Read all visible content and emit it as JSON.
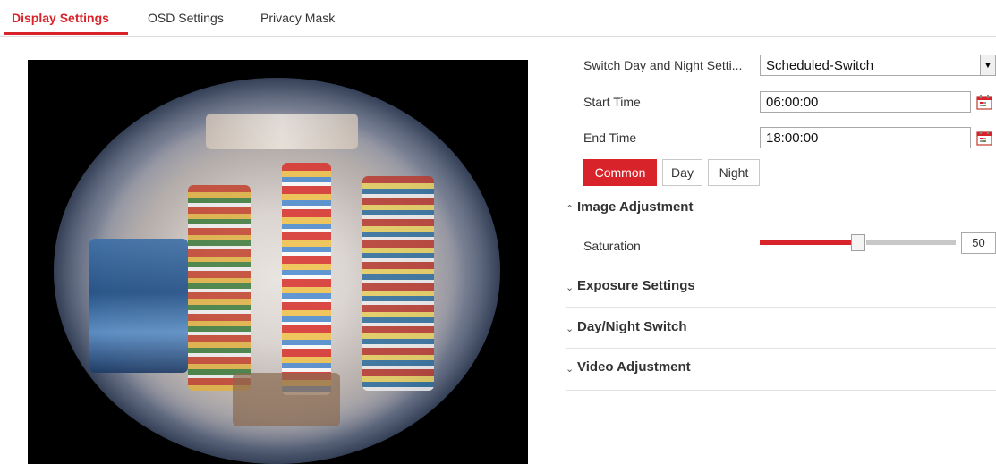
{
  "tabs": [
    {
      "label": "Display Settings",
      "active": true
    },
    {
      "label": "OSD Settings",
      "active": false
    },
    {
      "label": "Privacy Mask",
      "active": false
    }
  ],
  "colors": {
    "accent": "#d8232a",
    "divider": "#e2e2e2",
    "slider_rest": "#c8c8c8"
  },
  "settings": {
    "switch_day_night": {
      "label": "Switch Day and Night Setti...",
      "value": "Scheduled-Switch"
    },
    "start_time": {
      "label": "Start Time",
      "value": "06:00:00",
      "icon": "calendar-icon"
    },
    "end_time": {
      "label": "End Time",
      "value": "18:00:00",
      "icon": "calendar-icon"
    },
    "mode_buttons": [
      "Common",
      "Day",
      "Night"
    ],
    "active_mode": "Common"
  },
  "sections": {
    "image_adjustment": {
      "title": "Image Adjustment",
      "expanded": true,
      "saturation": {
        "label": "Saturation",
        "value": "50",
        "fraction": 0.5
      }
    },
    "exposure": {
      "title": "Exposure Settings",
      "expanded": false
    },
    "day_night_switch": {
      "title": "Day/Night Switch",
      "expanded": false
    },
    "video_adjustment": {
      "title": "Video Adjustment",
      "expanded": false
    }
  }
}
